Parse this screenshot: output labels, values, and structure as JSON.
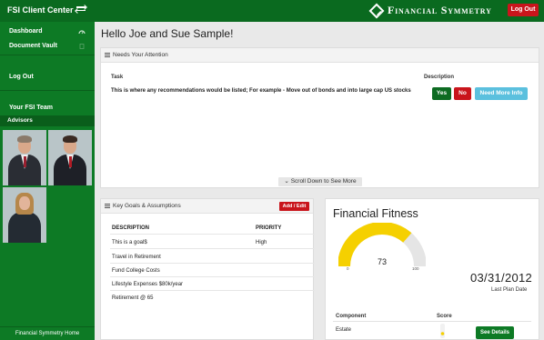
{
  "header": {
    "app_title": "FSI Client Center",
    "brand_name": "Financial Symmetry",
    "logout_label": "Log Out",
    "brand_color": "#0a6a1f",
    "logout_color": "#c9151c"
  },
  "sidebar": {
    "items": [
      {
        "label": "Dashboard",
        "icon": "dashboard-icon"
      },
      {
        "label": "Document Vault",
        "icon": "documents-icon"
      },
      {
        "label": "Log Out"
      },
      {
        "label": "Your FSI Team"
      }
    ],
    "advisors_label": "Advisors",
    "footer_label": "Financial Symmetry Home"
  },
  "main": {
    "greeting": "Hello Joe and Sue Sample!",
    "attention": {
      "title": "Needs Your Attention",
      "col_task": "Task",
      "col_description": "Description",
      "task_text": "This is where any recommendations would be listed; For example - Move out of bonds and into large cap US stocks",
      "yes_label": "Yes",
      "no_label": "No",
      "more_info_label": "Need More Info",
      "scroll_label": "Scroll Down to See More"
    },
    "goals": {
      "title": "Key Goals & Assumptions",
      "add_edit_label": "Add / Edit",
      "col_description": "DESCRIPTION",
      "col_priority": "PRIORITY",
      "rows": [
        {
          "description": "This is a goal$",
          "priority": "High"
        },
        {
          "description": "Travel in Retirement",
          "priority": ""
        },
        {
          "description": "Fund College Costs",
          "priority": ""
        },
        {
          "description": "Lifestyle Expenses $80k/year",
          "priority": ""
        },
        {
          "description": "Retirement @ 65",
          "priority": ""
        }
      ]
    },
    "fitness": {
      "title": "Financial Fitness",
      "score": 73,
      "gauge_min": "0",
      "gauge_max": "100",
      "gauge_fill_fraction": 0.73,
      "gauge_color": "#f5d000",
      "plan_date": "03/31/2012",
      "plan_date_label": "Last Plan Date",
      "col_component": "Component",
      "col_score": "Score",
      "components": [
        {
          "name": "Estate",
          "action": "See Details"
        }
      ]
    }
  }
}
